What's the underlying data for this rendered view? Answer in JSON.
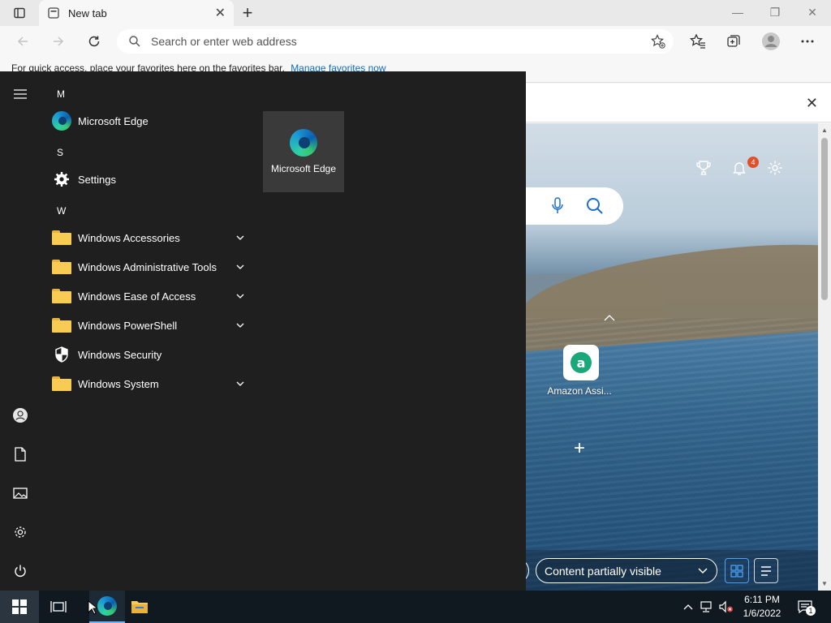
{
  "browser": {
    "tab": {
      "title": "New tab",
      "close_glyph": "✕"
    },
    "new_tab_glyph": "+",
    "window_controls": {
      "minimize": "—",
      "restore": "❐",
      "close": "✕"
    },
    "address_bar": {
      "placeholder": "Search or enter web address",
      "value": ""
    },
    "favorites_bar": {
      "message": "For quick access, place your favorites here on the favorites bar.",
      "link": "Manage favorites now"
    },
    "infobar_close_glyph": "✕"
  },
  "new_tab_page": {
    "notification_count": "4",
    "quick_links": [
      {
        "label": "Amazon Assi...",
        "logo_letter": "a"
      }
    ],
    "add_site_glyph": "+",
    "content_dropdown": {
      "label": "Content partially visible"
    },
    "colors": {
      "amazon": "#1aa87a",
      "badge": "#e0502b",
      "accent": "#4aa3ff"
    }
  },
  "start_menu": {
    "groups": [
      {
        "letter": "M",
        "apps": [
          {
            "label": "Microsoft Edge",
            "icon": "edge-icon",
            "expandable": false
          }
        ]
      },
      {
        "letter": "S",
        "apps": [
          {
            "label": "Settings",
            "icon": "gear-icon",
            "expandable": false
          }
        ]
      },
      {
        "letter": "W",
        "apps": [
          {
            "label": "Windows Accessories",
            "icon": "folder-icon",
            "expandable": true
          },
          {
            "label": "Windows Administrative Tools",
            "icon": "folder-icon",
            "expandable": true
          },
          {
            "label": "Windows Ease of Access",
            "icon": "folder-icon",
            "expandable": true
          },
          {
            "label": "Windows PowerShell",
            "icon": "folder-icon",
            "expandable": true
          },
          {
            "label": "Windows Security",
            "icon": "shield-icon",
            "expandable": false
          },
          {
            "label": "Windows System",
            "icon": "folder-icon",
            "expandable": true
          }
        ]
      }
    ],
    "pinned_tile": {
      "label": "Microsoft Edge",
      "icon": "edge-icon"
    },
    "rail": [
      "hamburger-menu-icon",
      "user-icon",
      "documents-icon",
      "pictures-icon",
      "settings-icon",
      "power-icon"
    ]
  },
  "taskbar": {
    "clock": {
      "time": "6:11 PM",
      "date": "1/6/2022"
    },
    "notification_count": "1",
    "pinned": [
      "task-view-icon",
      "edge-icon",
      "file-explorer-icon"
    ]
  }
}
